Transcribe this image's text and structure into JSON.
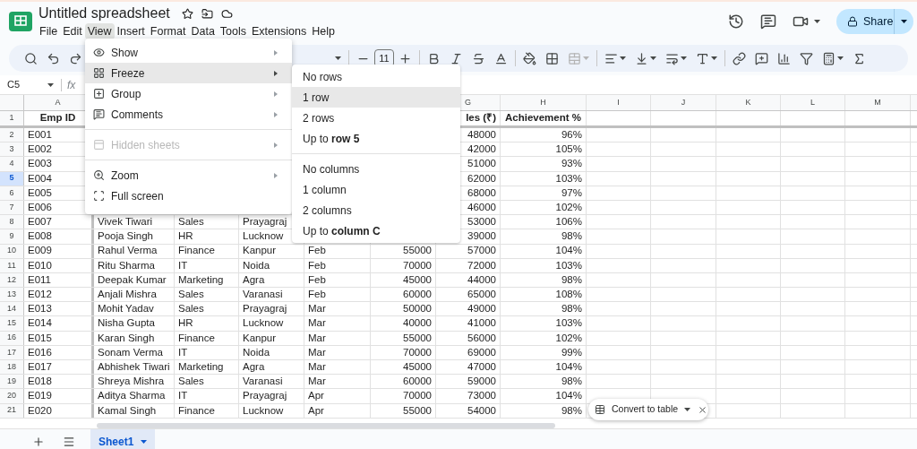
{
  "app": {
    "title": "Untitled spreadsheet",
    "menus": [
      {
        "label": "File",
        "selected": false
      },
      {
        "label": "Edit",
        "selected": false
      },
      {
        "label": "View",
        "selected": true
      },
      {
        "label": "Insert",
        "selected": false
      },
      {
        "label": "Format",
        "selected": false
      },
      {
        "label": "Data",
        "selected": false
      },
      {
        "label": "Tools",
        "selected": false
      },
      {
        "label": "Extensions",
        "selected": false
      },
      {
        "label": "Help",
        "selected": false
      }
    ],
    "share": "Share"
  },
  "toolbar": {
    "font_size": "11"
  },
  "formula_bar": {
    "name_box": "C5",
    "fx": "fx"
  },
  "sheet": {
    "columns": [
      {
        "label": "A",
        "selected": false
      },
      null,
      null,
      null,
      null,
      null,
      {
        "label": "G",
        "selected": false
      },
      {
        "label": "H",
        "selected": false
      },
      {
        "label": "I",
        "selected": false
      },
      {
        "label": "J",
        "selected": false
      },
      {
        "label": "K",
        "selected": false
      },
      {
        "label": "L",
        "selected": false
      },
      {
        "label": "M",
        "selected": false
      }
    ],
    "rows": [
      {
        "number": "1",
        "selected": false,
        "cells": [
          "Emp ID",
          null,
          null,
          null,
          null,
          null,
          "les (₹)",
          "Achievement %"
        ]
      },
      {
        "number": "2",
        "selected": false,
        "cells": [
          "E001",
          null,
          null,
          null,
          null,
          null,
          "48000",
          "96%"
        ]
      },
      {
        "number": "3",
        "selected": false,
        "cells": [
          "E002",
          null,
          null,
          null,
          null,
          null,
          "42000",
          "105%"
        ]
      },
      {
        "number": "4",
        "selected": false,
        "cells": [
          "E003",
          null,
          null,
          null,
          null,
          null,
          "51000",
          "93%"
        ]
      },
      {
        "number": "5",
        "selected": true,
        "cells": [
          "E004",
          null,
          null,
          null,
          null,
          null,
          "62000",
          "103%"
        ]
      },
      {
        "number": "6",
        "selected": false,
        "cells": [
          "E005",
          null,
          null,
          null,
          null,
          null,
          "68000",
          "97%"
        ]
      },
      {
        "number": "7",
        "selected": false,
        "cells": [
          "E006",
          null,
          null,
          null,
          null,
          null,
          "46000",
          "102%"
        ]
      },
      {
        "number": "8",
        "selected": false,
        "cells": [
          "E007",
          "Vivek Tiwari",
          "Sales",
          "Prayagraj",
          null,
          null,
          "53000",
          "106%"
        ]
      },
      {
        "number": "9",
        "selected": false,
        "cells": [
          "E008",
          "Pooja Singh",
          "HR",
          "Lucknow",
          null,
          null,
          "39000",
          "98%"
        ]
      },
      {
        "number": "10",
        "selected": false,
        "cells": [
          "E009",
          "Rahul Verma",
          "Finance",
          "Kanpur",
          "Feb",
          "55000",
          "57000",
          "104%"
        ]
      },
      {
        "number": "11",
        "selected": false,
        "cells": [
          "E010",
          "Ritu Sharma",
          "IT",
          "Noida",
          "Feb",
          "70000",
          "72000",
          "103%"
        ]
      },
      {
        "number": "12",
        "selected": false,
        "cells": [
          "E011",
          "Deepak Kumar",
          "Marketing",
          "Agra",
          "Feb",
          "45000",
          "44000",
          "98%"
        ]
      },
      {
        "number": "13",
        "selected": false,
        "cells": [
          "E012",
          "Anjali Mishra",
          "Sales",
          "Varanasi",
          "Feb",
          "60000",
          "65000",
          "108%"
        ]
      },
      {
        "number": "14",
        "selected": false,
        "cells": [
          "E013",
          "Mohit Yadav",
          "Sales",
          "Prayagraj",
          "Mar",
          "50000",
          "49000",
          "98%"
        ]
      },
      {
        "number": "15",
        "selected": false,
        "cells": [
          "E014",
          "Nisha Gupta",
          "HR",
          "Lucknow",
          "Mar",
          "40000",
          "41000",
          "103%"
        ]
      },
      {
        "number": "16",
        "selected": false,
        "cells": [
          "E015",
          "Karan Singh",
          "Finance",
          "Kanpur",
          "Mar",
          "55000",
          "56000",
          "102%"
        ]
      },
      {
        "number": "17",
        "selected": false,
        "cells": [
          "E016",
          "Sonam Verma",
          "IT",
          "Noida",
          "Mar",
          "70000",
          "69000",
          "99%"
        ]
      },
      {
        "number": "18",
        "selected": false,
        "cells": [
          "E017",
          "Abhishek Tiwari",
          "Marketing",
          "Agra",
          "Mar",
          "45000",
          "47000",
          "104%"
        ]
      },
      {
        "number": "19",
        "selected": false,
        "cells": [
          "E018",
          "Shreya Mishra",
          "Sales",
          "Varanasi",
          "Mar",
          "60000",
          "59000",
          "98%"
        ]
      },
      {
        "number": "20",
        "selected": false,
        "cells": [
          "E019",
          "Aditya Sharma",
          "IT",
          "Prayagraj",
          "Apr",
          "70000",
          "73000",
          "104%"
        ]
      },
      {
        "number": "21",
        "selected": false,
        "cells": [
          "E020",
          "Kamal Singh",
          "Finance",
          "Lucknow",
          "Apr",
          "55000",
          "54000",
          "98%"
        ]
      }
    ]
  },
  "view_menu": {
    "items": [
      {
        "kind": "item",
        "label": "Show",
        "submenu": true,
        "selected": false,
        "disabled": false
      },
      {
        "kind": "item",
        "label": "Freeze",
        "submenu": true,
        "selected": true,
        "disabled": false
      },
      {
        "kind": "item",
        "label": "Group",
        "submenu": true,
        "selected": false,
        "disabled": false
      },
      {
        "kind": "item",
        "label": "Comments",
        "submenu": true,
        "selected": false,
        "disabled": false
      },
      {
        "kind": "divider"
      },
      {
        "kind": "item",
        "label": "Hidden sheets",
        "submenu": true,
        "selected": false,
        "disabled": true
      },
      {
        "kind": "divider"
      },
      {
        "kind": "item",
        "label": "Zoom",
        "submenu": true,
        "selected": false,
        "disabled": false
      },
      {
        "kind": "item",
        "label": "Full screen",
        "submenu": false,
        "selected": false,
        "disabled": false
      }
    ]
  },
  "freeze_menu": {
    "items": [
      {
        "kind": "item",
        "label": "No rows",
        "selected": false
      },
      {
        "kind": "item",
        "label": "1 row",
        "selected": true
      },
      {
        "kind": "item",
        "label": "2 rows",
        "selected": false
      },
      {
        "kind": "item",
        "label": "Up to **row 5**",
        "selected": false
      },
      {
        "kind": "divider"
      },
      {
        "kind": "item",
        "label": "No columns",
        "selected": false
      },
      {
        "kind": "item",
        "label": "1 column",
        "selected": false
      },
      {
        "kind": "item",
        "label": "2 columns",
        "selected": false
      },
      {
        "kind": "item",
        "label": "Up to **column C**",
        "selected": false
      }
    ]
  },
  "chip": {
    "label": "Convert to table"
  },
  "sheet_tabs": [
    {
      "label": "Sheet1",
      "selected": true
    }
  ]
}
